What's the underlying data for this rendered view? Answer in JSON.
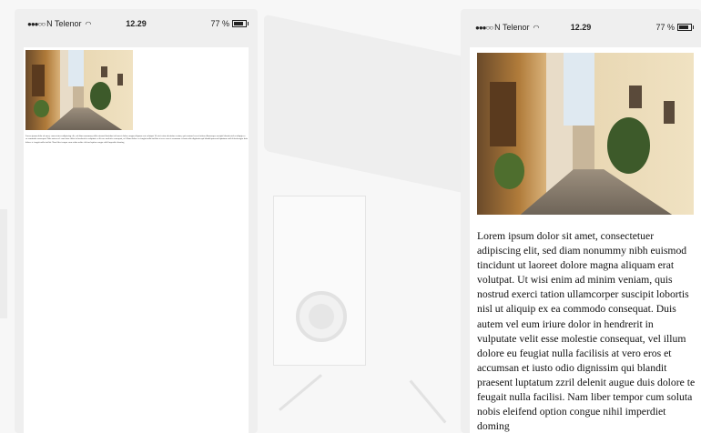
{
  "status_bar": {
    "signal": "●●●○○",
    "carrier": "N Telenor",
    "time": "12.29",
    "battery_percent": "77 %"
  },
  "article": {
    "text": "Lorem ipsum dolor sit amet, consectetuer adipiscing elit, sed diam nonummy nibh euismod tincidunt ut laoreet dolore magna aliquam erat volutpat. Ut wisi enim ad minim veniam, quis nostrud exerci tation ullamcorper suscipit lobortis nisl ut aliquip ex ea commodo consequat. Duis autem vel eum iriure dolor in hendrerit in vulputate velit esse molestie consequat, vel illum dolore eu feugiat nulla facilisis at vero eros et accumsan et iusto odio dignissim qui blandit praesent luptatum zzril delenit augue duis dolore te feugait nulla facilisi. Nam liber tempor cum soluta nobis eleifend option congue nihil imperdiet doming"
  }
}
